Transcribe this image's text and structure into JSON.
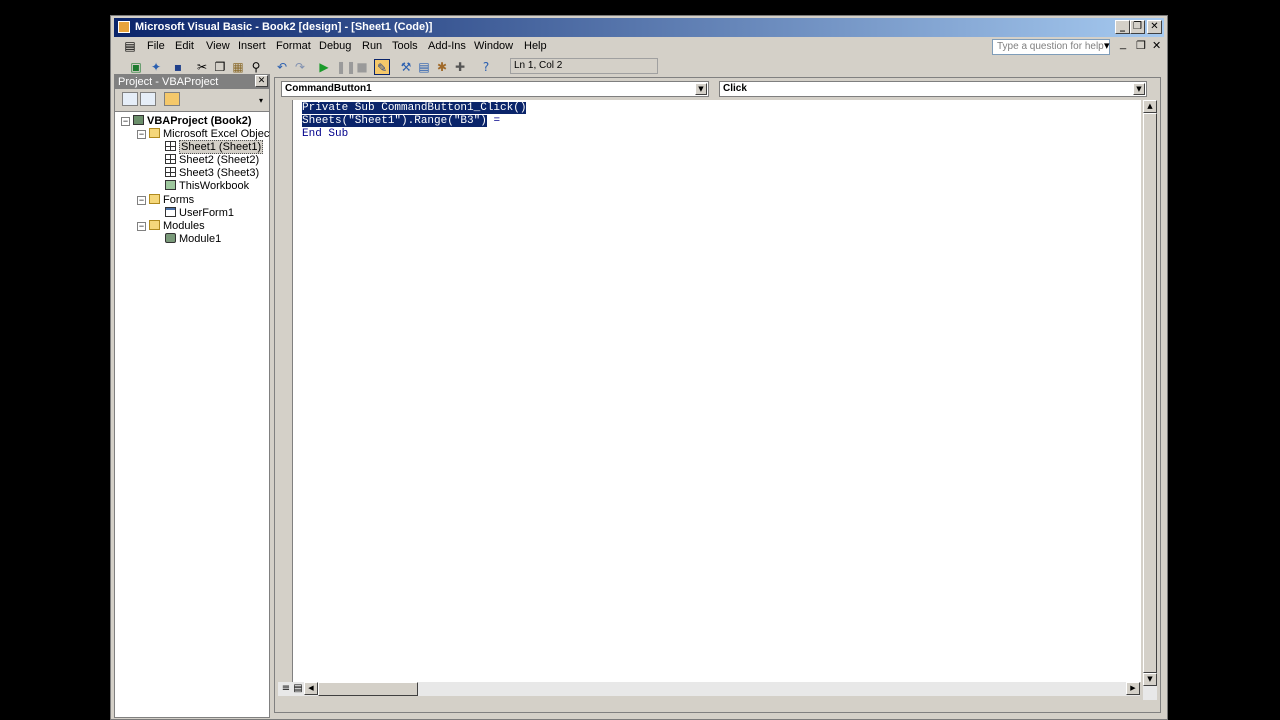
{
  "window": {
    "title": "Microsoft Visual Basic - Book2 [design] - [Sheet1 (Code)]",
    "controls": {
      "minimize": "_",
      "restore": "❐",
      "close": "✕"
    },
    "mdi_controls": {
      "minimize": "_",
      "restore": "❐",
      "close": "✕"
    }
  },
  "menubar": {
    "items": [
      "File",
      "Edit",
      "View",
      "Insert",
      "Format",
      "Debug",
      "Run",
      "Tools",
      "Add-Ins",
      "Window",
      "Help"
    ],
    "help_box_placeholder": "Type a question for help",
    "help_dropdown": "▾"
  },
  "toolbar": {
    "icons": [
      "excel-view-icon",
      "insert-object-icon",
      "save-icon",
      "cut-icon",
      "copy-icon",
      "paste-icon",
      "find-icon",
      "undo-icon",
      "redo-icon",
      "run-icon",
      "break-icon",
      "reset-icon",
      "design-mode-icon",
      "project-explorer-icon",
      "properties-window-icon",
      "object-browser-icon",
      "toolbox-icon",
      "help-icon"
    ],
    "position": "Ln 1, Col 2"
  },
  "project_panel": {
    "title": "Project - VBAProject",
    "close": "✕",
    "tree": {
      "root": "VBAProject (Book2)",
      "excel_objects_folder": "Microsoft Excel Objects",
      "sheet1": "Sheet1 (Sheet1)",
      "sheet2": "Sheet2 (Sheet2)",
      "sheet3": "Sheet3 (Sheet3)",
      "this_workbook": "ThisWorkbook",
      "forms_folder": "Forms",
      "userform1": "UserForm1",
      "modules_folder": "Modules",
      "module1": "Module1"
    },
    "expander": "−"
  },
  "code_window": {
    "object_combo": "CommandButton1",
    "procedure_combo": "Click",
    "combo_arrow": "▼",
    "lines": {
      "l1": "Private Sub CommandButton1_Click()",
      "l2_selected": "Sheets(\"Sheet1\").Range(\"B3\")",
      "l2_rest": " =",
      "l3": "End Sub"
    },
    "scroll": {
      "up": "▲",
      "down": "▼",
      "left": "◀",
      "right": "▶"
    }
  },
  "colors": {
    "title_gradient_start": "#0a246a",
    "title_gradient_end": "#a6caf0",
    "chrome": "#d4d0c8",
    "selection": "#0a246a",
    "code_text": "#00008b"
  }
}
